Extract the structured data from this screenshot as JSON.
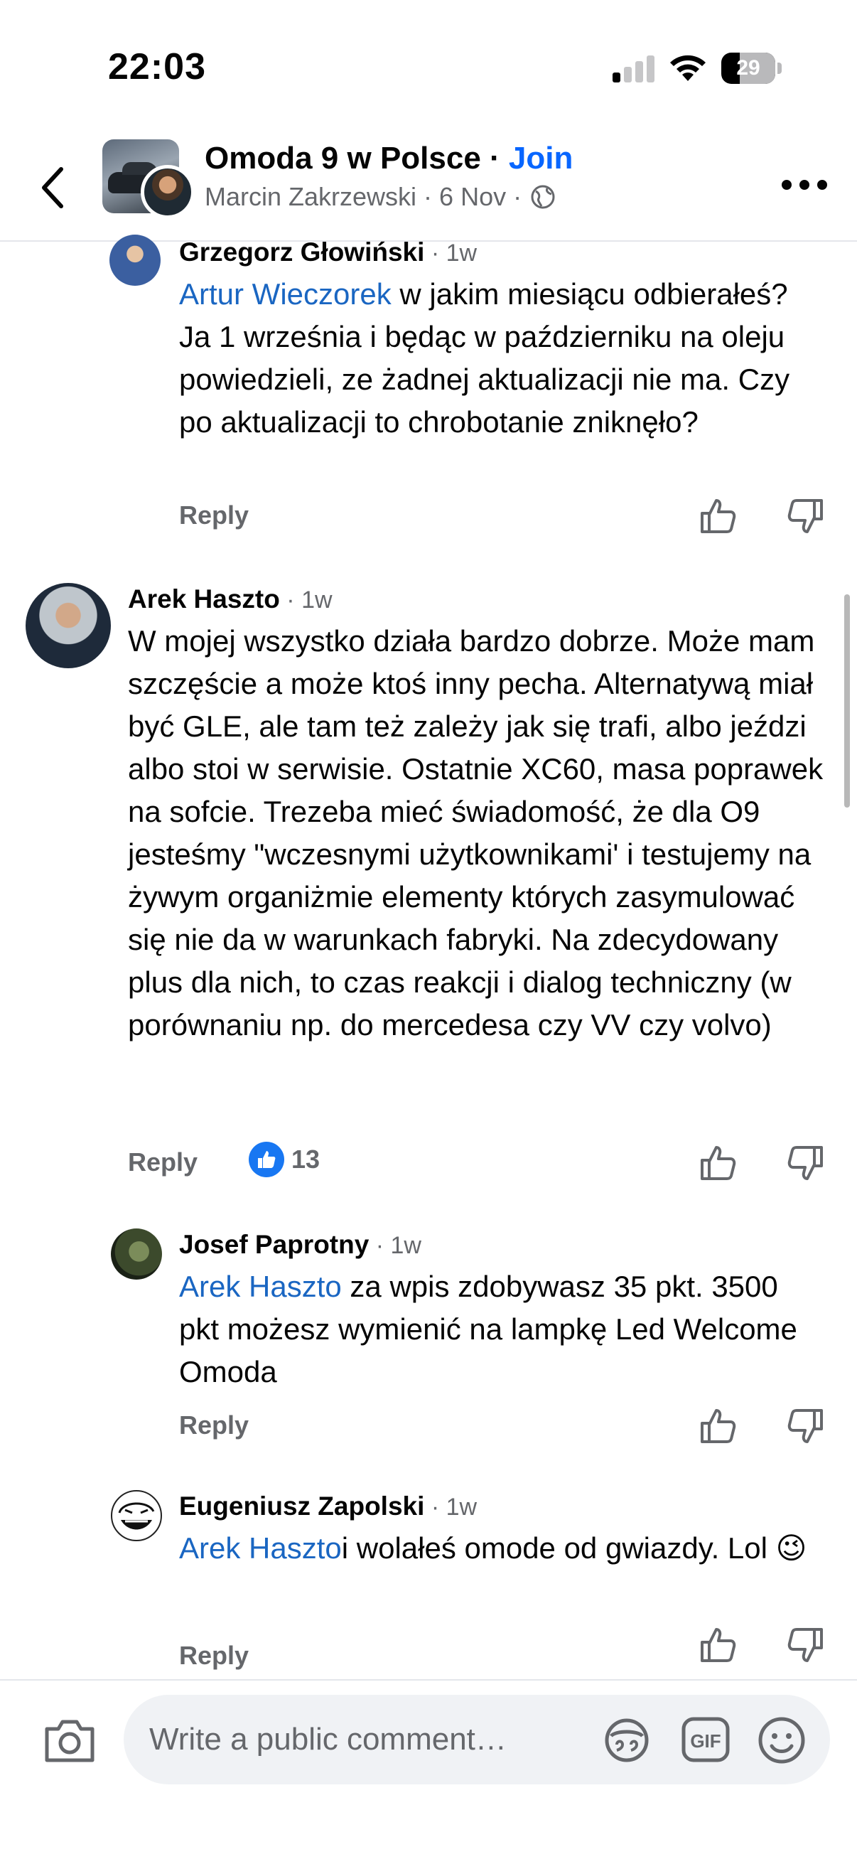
{
  "status_bar": {
    "time": "22:03",
    "battery": "29"
  },
  "header": {
    "group_name": "Omoda 9 w Polsce",
    "separator": " · ",
    "join_label": "Join",
    "poster_name": "Marcin Zakrzewski",
    "post_date": "6 Nov",
    "globe_icon": "globe-icon"
  },
  "comments": [
    {
      "author": "Grzegorz Głowiński",
      "time": " · 1w",
      "mention": "Artur Wieczorek",
      "text": " w jakim miesiącu odbierałeś? Ja 1 września i będąc w październiku na oleju powiedzieli, ze żadnej aktualizacji nie ma. Czy po aktualizacji to chrobotanie zniknęło?",
      "reply_label": "Reply"
    },
    {
      "author": "Arek Haszto",
      "time": " · 1w",
      "mention": "",
      "text": "W mojej wszystko działa bardzo dobrze. Może mam szczęście a może ktoś inny pecha. Alternatywą miał być GLE, ale tam też zależy jak się trafi, albo jeździ albo stoi w serwisie. Ostatnie XC60, masa poprawek na sofcie. Trezeba mieć świadomość, że dla O9 jesteśmy \"wczesnymi użytkownikami' i testujemy na żywym organiżmie elementy których zasymulować się nie da w warunkach fabryki. Na zdecydowany plus dla nich, to czas reakcji i dialog techniczny (w porównaniu np. do mercedesa czy VV czy volvo)",
      "reply_label": "Reply",
      "reaction_count": "13"
    },
    {
      "author": "Josef Paprotny",
      "time": " · 1w",
      "mention": "Arek Haszto",
      "text": " za wpis zdobywasz 35 pkt. 3500 pkt możesz wymienić na lampkę Led Welcome Omoda",
      "reply_label": "Reply"
    },
    {
      "author": "Eugeniusz Zapolski",
      "time": " · 1w",
      "mention": "Arek Haszto",
      "text": "i wolałeś omode od gwiazdy. Lol 😉",
      "reply_label": "Reply"
    }
  ],
  "composer": {
    "placeholder": "Write a public comment…"
  },
  "icons": {
    "like": "thumbs-up-icon",
    "dislike": "thumbs-down-icon",
    "camera": "camera-icon",
    "gif": "gif-icon",
    "emoji": "emoji-icon",
    "avatar_sticker": "avatar-sticker-icon"
  },
  "colors": {
    "mention": "#1a66c2",
    "join": "#0866ff",
    "like_badge": "#1877f2",
    "secondary_text": "#65676b"
  }
}
